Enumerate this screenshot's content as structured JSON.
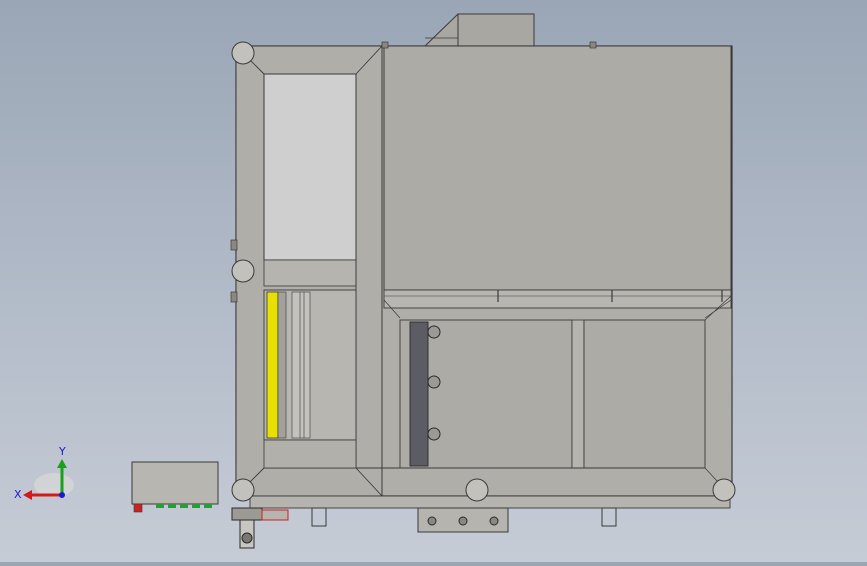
{
  "viewport": {
    "background_top": "#9aa6b6",
    "background_bottom": "#c6ccd6",
    "model_body_color": "#b0aea8",
    "panel_color": "#adaba5",
    "window_color": "#cfcfcf",
    "edge_color": "#3a3a3a",
    "highlight_color": "#e8e000",
    "accent_red": "#cc2222",
    "accent_green": "#2a9a3a"
  },
  "triad": {
    "x_label": "X",
    "y_label": "Y",
    "x_color": "#d11a1a",
    "y_color": "#1aa01a",
    "z_color": "#1a1ad1"
  }
}
